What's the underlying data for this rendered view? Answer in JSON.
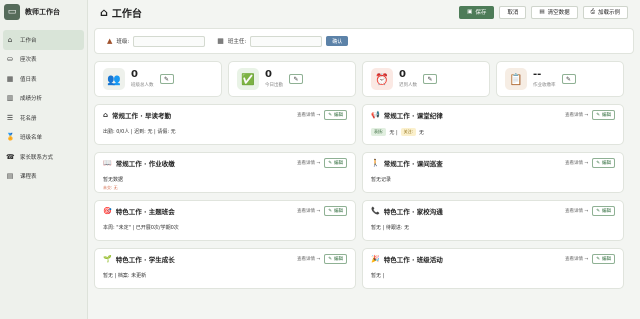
{
  "app": {
    "name": "教师工作台"
  },
  "sidebar": {
    "items": [
      {
        "label": "工作台",
        "icon": "home-icon",
        "glyph": "⌂",
        "active": true
      },
      {
        "label": "座次表",
        "icon": "seat-icon",
        "glyph": "⛀"
      },
      {
        "label": "值日表",
        "icon": "calendar-icon",
        "glyph": "▦"
      },
      {
        "label": "成绩分析",
        "icon": "chart-icon",
        "glyph": "▥"
      },
      {
        "label": "花名册",
        "icon": "list-icon",
        "glyph": "☰"
      },
      {
        "label": "班级名单",
        "icon": "medal-icon",
        "glyph": "🏅"
      },
      {
        "label": "家长联系方式",
        "icon": "phone-icon",
        "glyph": "☎"
      },
      {
        "label": "课程表",
        "icon": "timetable-icon",
        "glyph": "▤"
      }
    ]
  },
  "header": {
    "title": "工作台",
    "save": "保存",
    "cancel": "取消",
    "clear": "清空数据",
    "add_example": "加载示例"
  },
  "info": {
    "class_label": "班级:",
    "teacher_label": "班主任:",
    "confirm": "确认"
  },
  "stats": [
    {
      "value": "0",
      "label": "班级总人数",
      "icon": "people-icon",
      "glyph": "👥",
      "bg": "#eef1ec"
    },
    {
      "value": "0",
      "label": "今日出勤",
      "icon": "check-icon",
      "glyph": "✅",
      "bg": "#e9f3e6"
    },
    {
      "value": "0",
      "label": "迟到人数",
      "icon": "alarm-icon",
      "glyph": "⏰",
      "bg": "#fbe9e4"
    },
    {
      "value": "--",
      "label": "作业收缴率",
      "icon": "note-icon",
      "glyph": "📋",
      "bg": "#f6ede4"
    }
  ],
  "cards": {
    "detail": "查看详情 →",
    "edit": "编辑",
    "items": [
      {
        "title": "常规工作 · 早读考勤",
        "icon": "home-icon",
        "glyph": "⌂",
        "body": "出勤: 0/0人 | 迟到: 无 | 请假: 无"
      },
      {
        "title": "常规工作 · 课堂纪律",
        "icon": "megaphone-icon",
        "glyph": "📢",
        "body": "无 |",
        "tag1": "表扬:",
        "tag2": "关注:",
        "body2": "无"
      },
      {
        "title": "常规工作 · 作业收缴",
        "icon": "book-icon",
        "glyph": "📖",
        "body": "暂无数据",
        "sub": "未交: 无"
      },
      {
        "title": "常规工作 · 课间巡查",
        "icon": "person-icon",
        "glyph": "🚶",
        "body": "暂无记录"
      },
      {
        "title": "特色工作 · 主题班会",
        "icon": "target-icon",
        "glyph": "🎯",
        "body": "本周: \"未定\" | 已开展0次/学期0次"
      },
      {
        "title": "特色工作 · 家校沟通",
        "icon": "phone-icon",
        "glyph": "📞",
        "body": "暂无 | 待跟进: 无"
      },
      {
        "title": "特色工作 · 学生成长",
        "icon": "sprout-icon",
        "glyph": "🌱",
        "body": "暂无 | 档案: 未更新"
      },
      {
        "title": "特色工作 · 班级活动",
        "icon": "party-icon",
        "glyph": "🎉",
        "body": "暂无 |"
      }
    ]
  }
}
